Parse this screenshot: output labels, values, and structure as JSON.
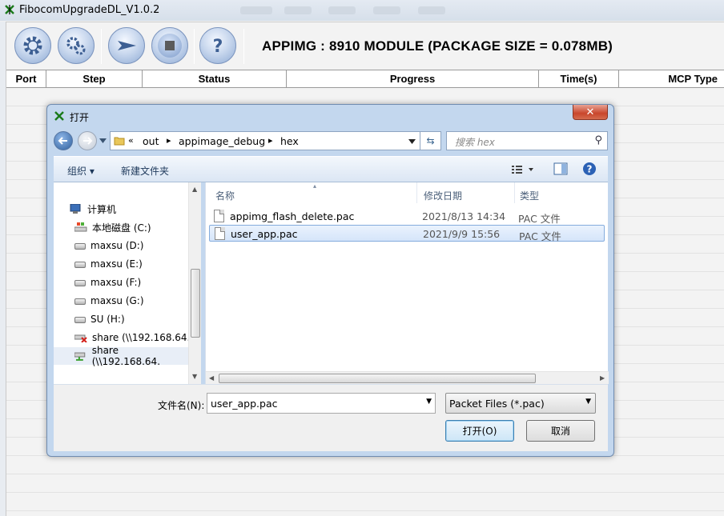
{
  "app": {
    "title": "FibocomUpgradeDL_V1.0.2",
    "headline": "APPIMG : 8910 MODULE (PACKAGE SIZE = 0.078MB)",
    "toolbar": [
      {
        "icon": "gear-icon"
      },
      {
        "icon": "settings-gears-icon"
      },
      {
        "icon": "start-arrow-icon"
      },
      {
        "icon": "stop-square-icon"
      },
      {
        "icon": "help-question-icon"
      }
    ],
    "columns": [
      "Port",
      "Step",
      "Status",
      "Progress",
      "Time(s)",
      "MCP Type"
    ]
  },
  "dialog": {
    "title": "打开",
    "close_glyph": "✕",
    "breadcrumb": {
      "prefix": "«",
      "items": [
        "out",
        "appimage_debug",
        "hex"
      ]
    },
    "search_placeholder": "搜索 hex",
    "commands": {
      "organize": "组织 ▾",
      "new_folder": "新建文件夹"
    },
    "tree": [
      {
        "label": "计算机",
        "icon": "computer-icon",
        "selected": false
      },
      {
        "label": "本地磁盘 (C:)",
        "icon": "system-drive-icon",
        "selected": false
      },
      {
        "label": "maxsu (D:)",
        "icon": "drive-icon",
        "selected": false
      },
      {
        "label": "maxsu (E:)",
        "icon": "drive-icon",
        "selected": false
      },
      {
        "label": "maxsu (F:)",
        "icon": "drive-icon",
        "selected": false
      },
      {
        "label": "maxsu (G:)",
        "icon": "drive-icon",
        "selected": false
      },
      {
        "label": "SU (H:)",
        "icon": "drive-icon",
        "selected": false
      },
      {
        "label": "share (\\\\192.168.64.",
        "icon": "disconnected-network-drive-icon",
        "selected": false
      },
      {
        "label": "share (\\\\192.168.64.",
        "icon": "network-drive-icon",
        "selected": true
      }
    ],
    "file_columns": {
      "name": "名称",
      "date": "修改日期",
      "type": "类型"
    },
    "files": [
      {
        "name": "appimg_flash_delete.pac",
        "date": "2021/8/13 14:34",
        "type": "PAC 文件",
        "selected": false
      },
      {
        "name": "user_app.pac",
        "date": "2021/9/9 15:56",
        "type": "PAC 文件",
        "selected": true
      }
    ],
    "filename_label": "文件名(N):",
    "filename_value": "user_app.pac",
    "filter_value": "Packet Files (*.pac)",
    "open_button": "打开(O)",
    "cancel_button": "取消"
  }
}
